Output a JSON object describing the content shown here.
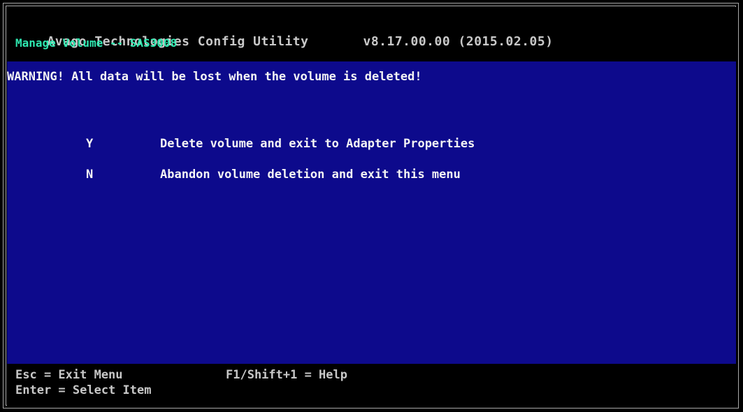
{
  "header": {
    "title": "Avago Technologies Config Utility",
    "version": "v8.17.00.00 (2015.02.05)",
    "subtitle": "Manage Volume -- SAS3008"
  },
  "main": {
    "warning": "WARNING! All data will be lost when the volume is deleted!",
    "options": [
      {
        "key": "Y",
        "label": "Delete volume and exit to Adapter Properties"
      },
      {
        "key": "N",
        "label": "Abandon volume deletion and exit this menu"
      }
    ]
  },
  "footer": {
    "esc_hint": "Esc = Exit Menu",
    "help_hint": "F1/Shift+1 = Help",
    "enter_hint": "Enter = Select Item"
  },
  "colors": {
    "background": "#0d0a8c",
    "header_bg": "#000000",
    "subtitle": "#2ee8b0",
    "text": "#f4f4f4",
    "dim_text": "#c8c8c8"
  }
}
